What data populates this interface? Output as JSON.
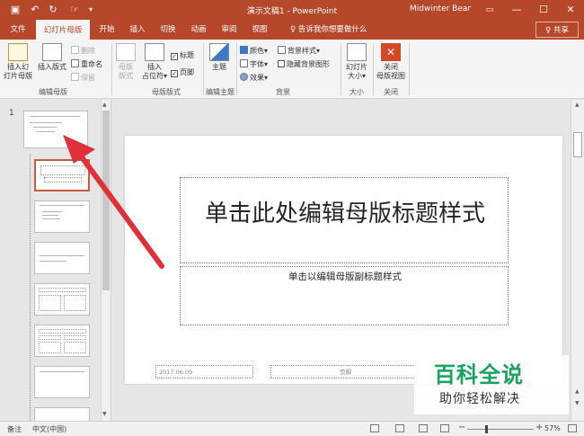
{
  "titlebar": {
    "doc_title": "演示文稿1  -  PowerPoint",
    "user": "Midwinter Bear",
    "save_icon": "save-icon",
    "undo_icon": "undo-icon",
    "redo_icon": "redo-icon",
    "touch_icon": "touch-mode-icon",
    "minimize": "—",
    "restore": "☐",
    "close": "✕",
    "ribbon_display": "▭"
  },
  "tabs": [
    {
      "label": "文件"
    },
    {
      "label": "幻灯片母版"
    },
    {
      "label": "开始"
    },
    {
      "label": "插入"
    },
    {
      "label": "切换"
    },
    {
      "label": "动画"
    },
    {
      "label": "审阅"
    },
    {
      "label": "视图"
    }
  ],
  "tellme": "♀ 告诉我你想要做什么",
  "share": "♀ 共享",
  "ribbon": {
    "insert_master": "插入幻\n灯片母版",
    "insert_layout": "插入版式",
    "delete": "删除",
    "rename": "重命名",
    "preserve": "保留",
    "group_edit_master": "编辑母版",
    "master_layout": "母版\n版式",
    "insert_placeholder": "插入\n占位符▾",
    "title_check": "标题",
    "footer_check": "页脚",
    "group_master_layout": "母版版式",
    "themes": "主题",
    "group_edit_theme": "编辑主题",
    "colors": "颜色▾",
    "fonts": "字体▾",
    "effects": "效果▾",
    "bg_styles": "背景样式▾",
    "hide_bg": "隐藏背景图形",
    "group_background": "背景",
    "slide_size": "幻灯片\n大小▾",
    "group_size": "大小",
    "close_master": "关闭\n母版视图",
    "group_close": "关闭"
  },
  "thumbs": {
    "slide_number": "1"
  },
  "slide": {
    "title": "单击此处编辑母版标题样式",
    "subtitle": "单击以编辑母版副标题样式",
    "date": "2017.06.09",
    "footer": "页脚"
  },
  "watermark": {
    "logo": "百科全说",
    "tagline": "助你轻松解决"
  },
  "status": {
    "notes": "备注",
    "language": "中文(中国)",
    "zoom": "57%",
    "zoom_level": 0.57
  },
  "colors": {
    "accent": "#b7472a",
    "arrow": "#e0303a",
    "watermark_green": "#1aa260"
  }
}
